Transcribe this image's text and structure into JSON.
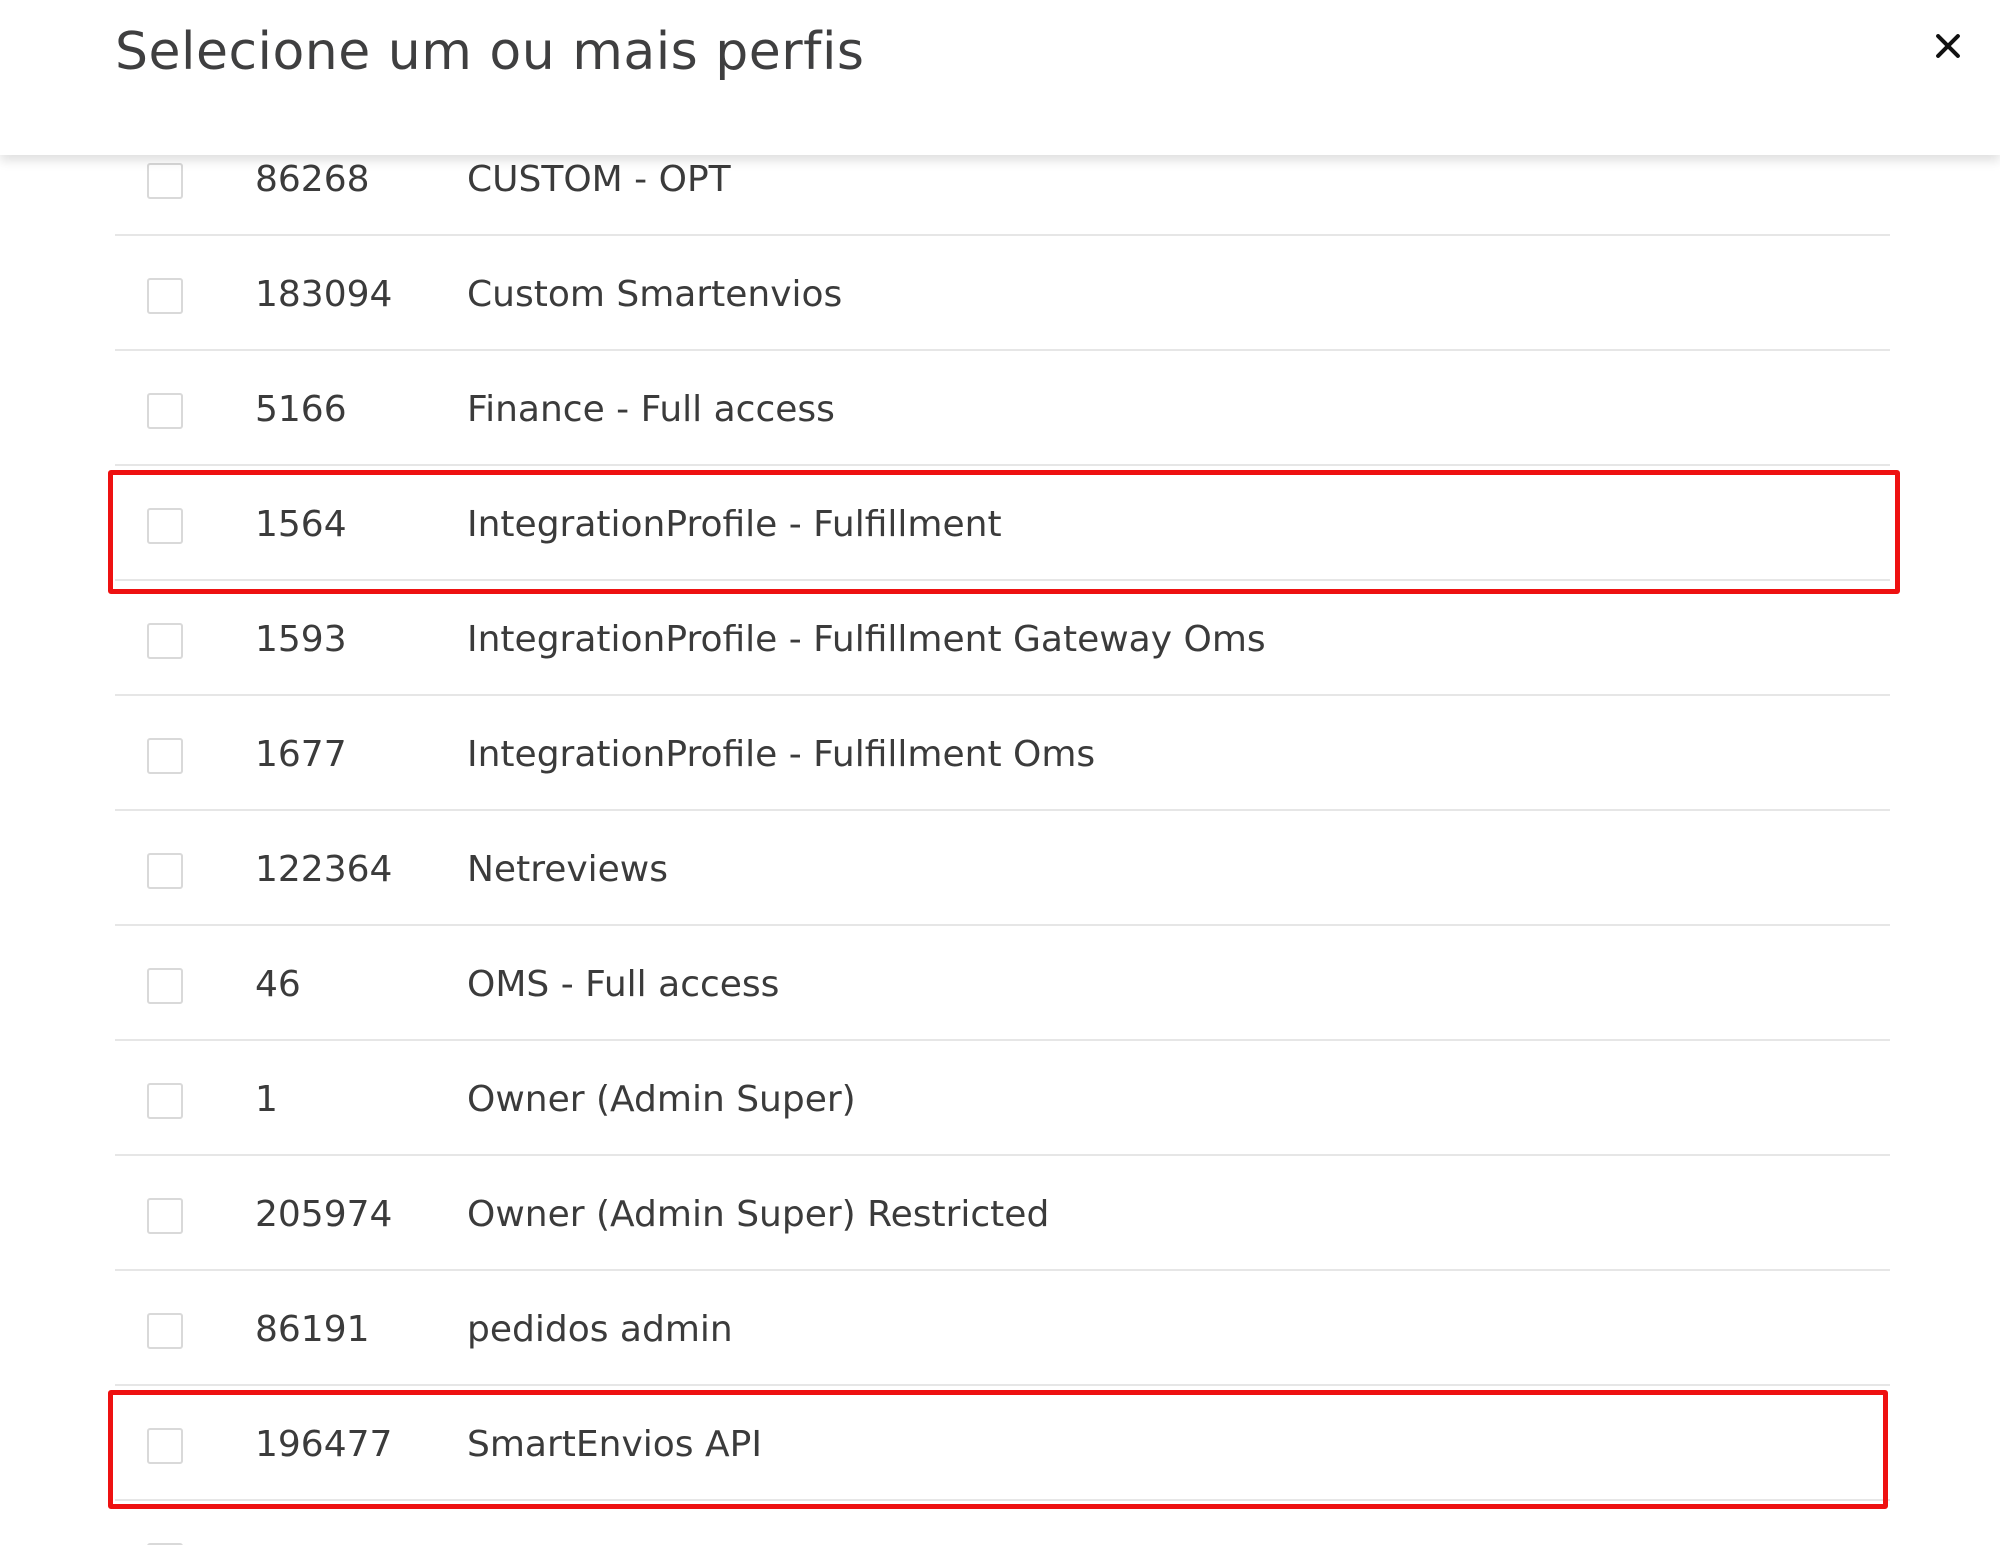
{
  "dialog": {
    "title": "Selecione um ou mais perfis",
    "close_icon": "close-icon"
  },
  "profiles": [
    {
      "id": "86268",
      "name": "CUSTOM - OPT",
      "checked": false
    },
    {
      "id": "183094",
      "name": "Custom Smartenvios",
      "checked": false
    },
    {
      "id": "5166",
      "name": "Finance - Full access",
      "checked": false
    },
    {
      "id": "1564",
      "name": "IntegrationProfile - Fulfillment",
      "checked": false,
      "highlighted": true
    },
    {
      "id": "1593",
      "name": "IntegrationProfile - Fulfillment Gateway Oms",
      "checked": false
    },
    {
      "id": "1677",
      "name": "IntegrationProfile - Fulfillment Oms",
      "checked": false
    },
    {
      "id": "122364",
      "name": "Netreviews",
      "checked": false
    },
    {
      "id": "46",
      "name": "OMS - Full access",
      "checked": false
    },
    {
      "id": "1",
      "name": "Owner (Admin Super)",
      "checked": false
    },
    {
      "id": "205974",
      "name": "Owner (Admin Super) Restricted",
      "checked": false
    },
    {
      "id": "86191",
      "name": "pedidos admin",
      "checked": false
    },
    {
      "id": "196477",
      "name": "SmartEnvios API",
      "checked": false,
      "highlighted": true
    }
  ],
  "highlight_color": "#ee1111"
}
